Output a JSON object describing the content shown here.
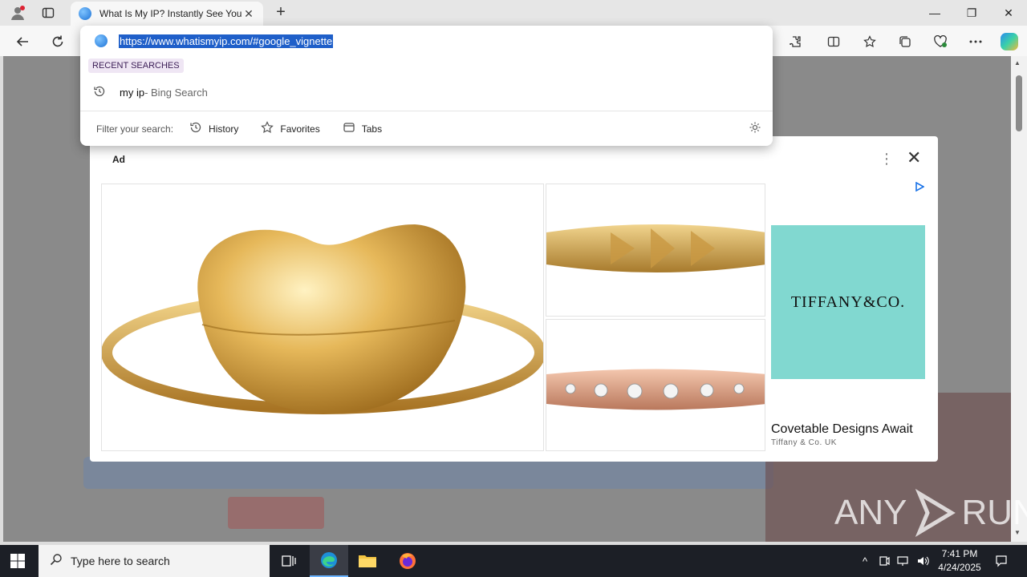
{
  "browser": {
    "tab_title": "What Is My IP? Instantly See Your",
    "tab_close": "✕",
    "newtab": "+",
    "window_controls": {
      "minimize": "—",
      "restore": "❐",
      "close": "✕"
    }
  },
  "omnibox": {
    "url": "https://www.whatismyip.com/#google_vignette",
    "recent_label": "RECENT SEARCHES",
    "suggestion_query": "my ip",
    "suggestion_source": " - Bing Search",
    "filter_label": "Filter your search:",
    "filters": [
      {
        "label": "History",
        "icon": "history-icon"
      },
      {
        "label": "Favorites",
        "icon": "star-icon"
      },
      {
        "label": "Tabs",
        "icon": "tabs-icon"
      }
    ]
  },
  "ad": {
    "label": "Ad",
    "brand": "TIFFANY&CO.",
    "headline": "Covetable Designs Await",
    "advertiser": "Tiffany & Co. UK",
    "brand_color": "#81d8d0"
  },
  "watermark": {
    "left": "ANY",
    "right": "RUN"
  },
  "taskbar": {
    "search_placeholder": "Type here to search",
    "time": "7:41 PM",
    "date": "4/24/2025"
  }
}
